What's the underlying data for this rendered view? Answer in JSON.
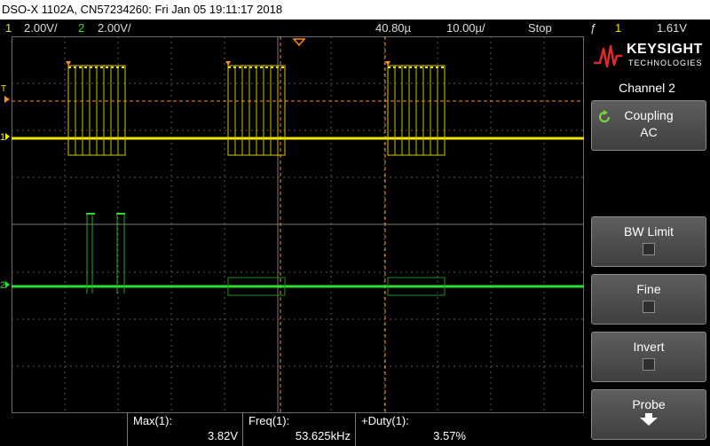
{
  "title_bar": "DSO-X 1102A, CN57234260: Fri Jan 05 19:11:17 2018",
  "status": {
    "ch1_num": "1",
    "ch1_scale": "2.00V/",
    "ch2_num": "2",
    "ch2_scale": "2.00V/",
    "delay": "40.80µ",
    "timebase": "10.00µ/",
    "run_state": "Stop",
    "trigger_icon": "ƒ",
    "trigger_channel": "1",
    "trigger_level": "1.61V"
  },
  "side_panel": {
    "brand": "KEYSIGHT",
    "brand_sub": "TECHNOLOGIES",
    "title": "Channel 2",
    "coupling_label": "Coupling",
    "coupling_value": "AC",
    "bw_limit_label": "BW Limit",
    "fine_label": "Fine",
    "invert_label": "Invert",
    "probe_label": "Probe"
  },
  "markers": {
    "trigger_marker": "T",
    "ch1_ground": "1",
    "ch2_ground": "2"
  },
  "measurements": [
    {
      "label": "Max(1):",
      "value": "3.82V"
    },
    {
      "label": "Freq(1):",
      "value": "53.625kHz"
    },
    {
      "label": "+Duty(1):",
      "value": "3.57%"
    }
  ],
  "colors": {
    "channel1": "#f2e600",
    "channel2": "#2ede2e",
    "cursor": "#ff8a1e",
    "grid": "#5a5a5a"
  },
  "icons": {
    "coupling": "cycle-arrow-icon",
    "probe": "down-arrow-icon",
    "trigger": "trigger-edge-icon",
    "logo": "keysight-wave-icon"
  }
}
